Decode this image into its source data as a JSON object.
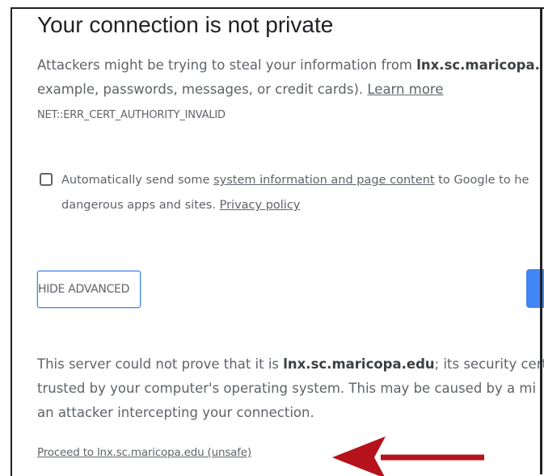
{
  "page": {
    "title": "Your connection is not private",
    "warning": {
      "prefix": "Attackers might be trying to steal your information from ",
      "domain": "lnx.sc.maricopa.",
      "line2_prefix": "example, passwords, messages, or credit cards). ",
      "learn_more": "Learn more"
    },
    "error_code": "NET::ERR_CERT_AUTHORITY_INVALID",
    "checkbox": {
      "checked": false,
      "text_prefix": "Automatically send some ",
      "link": "system information and page content",
      "text_suffix": " to Google to he",
      "line2_prefix": "dangerous apps and sites. ",
      "privacy_link": "Privacy policy"
    },
    "hide_advanced_label": "HIDE ADVANCED",
    "details": {
      "prefix": "This server could not prove that it is ",
      "domain": "lnx.sc.maricopa.edu",
      "suffix": "; its security cert",
      "line2": "trusted by your computer's operating system. This may be caused by a mi",
      "line3": "an attacker intercepting your connection."
    },
    "proceed_link": "Proceed to lnx.sc.maricopa.edu (unsafe)"
  },
  "colors": {
    "text": "#5f6368",
    "title": "#202124",
    "accent_blue": "#4285f4",
    "arrow_red": "#b5121b"
  }
}
